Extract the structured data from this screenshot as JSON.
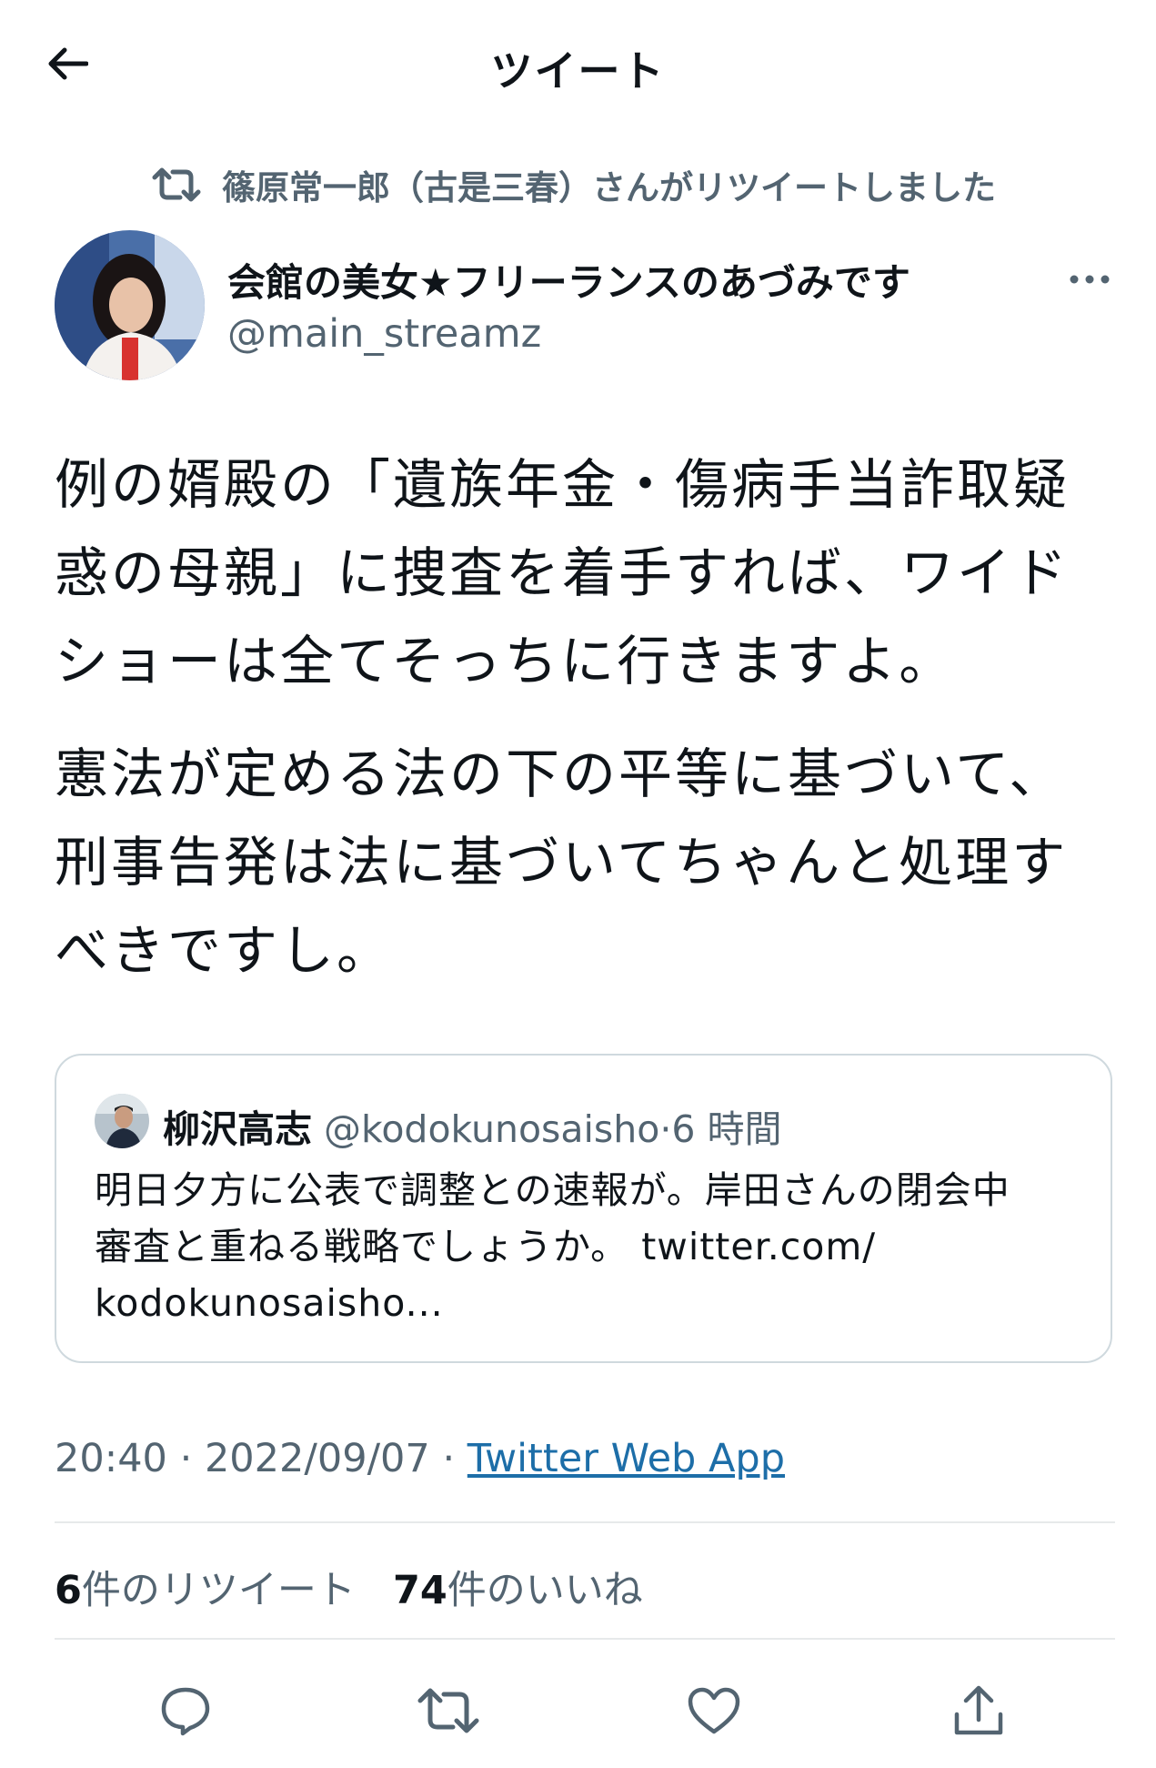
{
  "header": {
    "title": "ツイート"
  },
  "retweet_context": {
    "text": "篠原常一郎（古是三春）さんがリツイートしました"
  },
  "author": {
    "name": "会館の美女★フリーランスのあづみです",
    "handle": "@main_streamz"
  },
  "tweet": {
    "paragraphs": [
      [
        "例の婿殿の「遺族年金・傷病手当詐取疑",
        "惑の母親」に捜査を着手すれば、ワイド",
        "ショーは全てそっちに行きますよ。"
      ],
      [
        "憲法が定める法の下の平等に基づいて、",
        "刑事告発は法に基づいてちゃんと処理す",
        "べきですし。"
      ]
    ]
  },
  "quote": {
    "name": "柳沢高志",
    "handle": "@kodokunosaisho",
    "time": "6 時間",
    "lines": [
      "明日夕方に公表で調整との速報が。岸田さんの閉会中",
      "審査と重ねる戦略でしょうか。"
    ],
    "link_part1": "twitter.com/",
    "link_part2": "kodokunosaisho..."
  },
  "meta": {
    "time": "20:40",
    "date": "2022/09/07",
    "source": "Twitter Web App",
    "sep": "·"
  },
  "stats": {
    "retweets_count": "6",
    "retweets_label": "件のリツイート",
    "likes_count": "74",
    "likes_label": "件のいいね"
  },
  "icons": [
    "back-arrow-icon",
    "retweet-icon",
    "more-icon",
    "reply-icon",
    "retweet-icon",
    "like-icon",
    "share-icon"
  ],
  "colors": {
    "text": "#0f1419",
    "secondary": "#536471",
    "border": "#cfd9de",
    "link": "#1d6ea8"
  }
}
